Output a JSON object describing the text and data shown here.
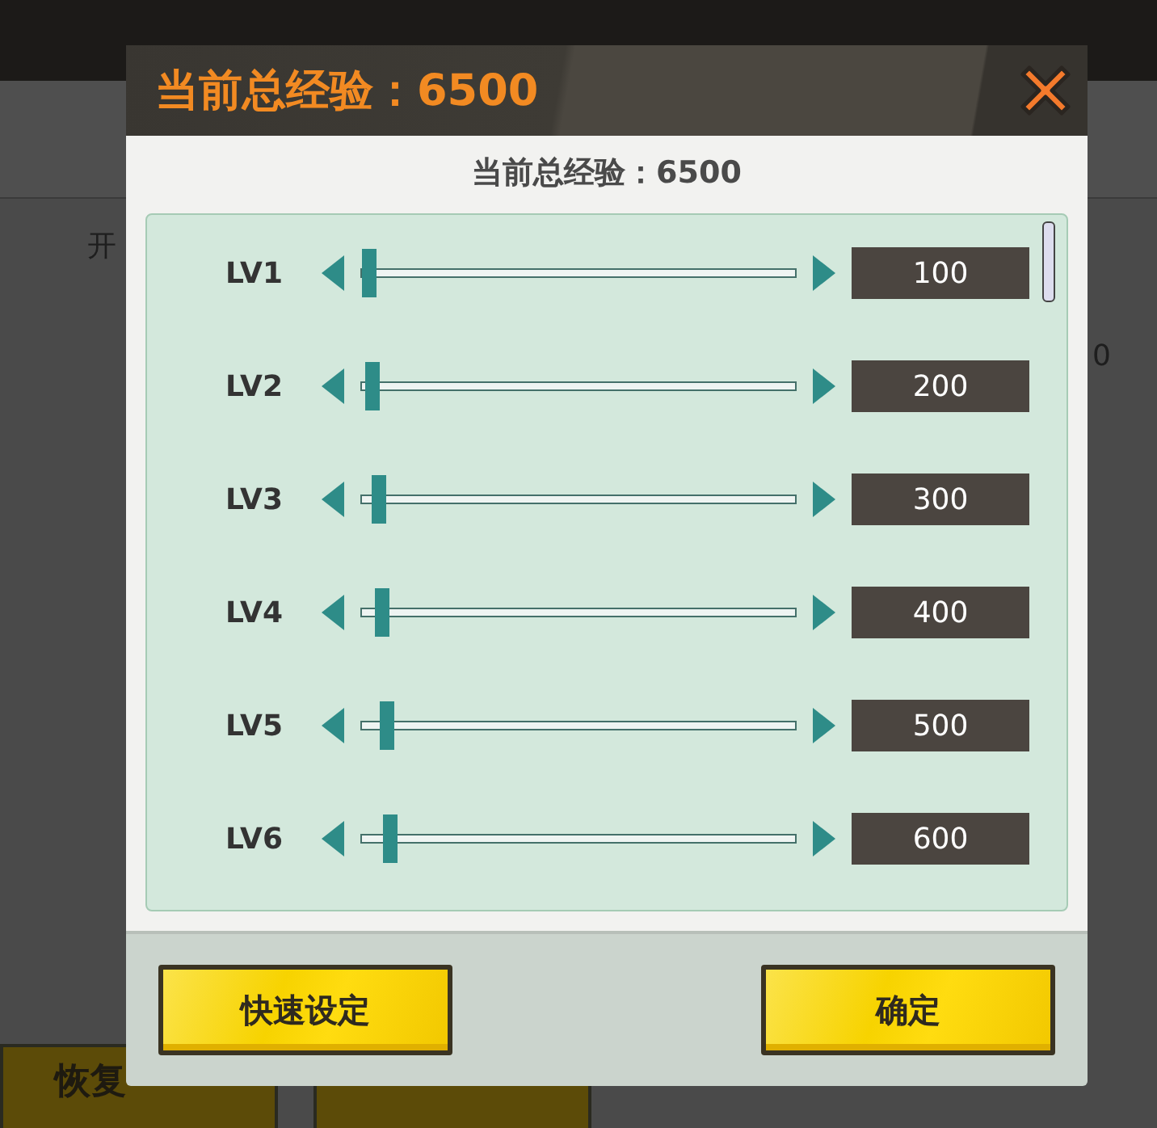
{
  "background": {
    "side_label": "开",
    "side_value": "0",
    "buttons": [
      "恢复"
    ]
  },
  "dialog": {
    "title": "当前总经验：6500",
    "subtitle": "当前总经验：6500",
    "levels": [
      {
        "label": "LV1",
        "level": 0.02,
        "value": "100"
      },
      {
        "label": "LV2",
        "level": 0.027,
        "value": "200"
      },
      {
        "label": "LV3",
        "level": 0.04,
        "value": "300"
      },
      {
        "label": "LV4",
        "level": 0.048,
        "value": "400"
      },
      {
        "label": "LV5",
        "level": 0.059,
        "value": "500"
      },
      {
        "label": "LV6",
        "level": 0.067,
        "value": "600"
      }
    ],
    "buttons": [
      "快速设定",
      "确定"
    ]
  }
}
